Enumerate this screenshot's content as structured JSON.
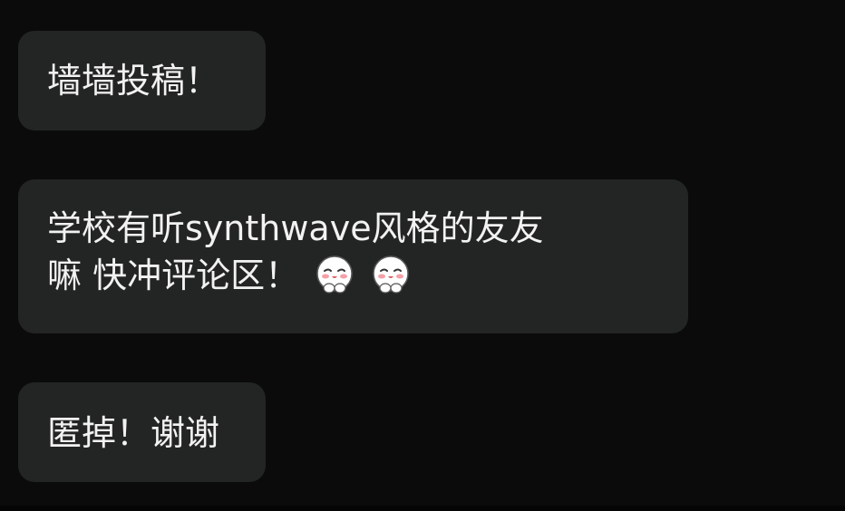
{
  "messages": [
    {
      "lines": [
        "墙墙投稿！"
      ]
    },
    {
      "lines": [
        "学校有听synthwave风格的友友",
        "嘛 快冲评论区！"
      ],
      "emojis": [
        "blushing-face-emoji",
        "blushing-face-emoji"
      ]
    },
    {
      "lines": [
        "匿掉！谢谢"
      ]
    }
  ],
  "colors": {
    "background": "#0b0b0c",
    "bubble": "#232524",
    "text": "#f2f2f2"
  }
}
